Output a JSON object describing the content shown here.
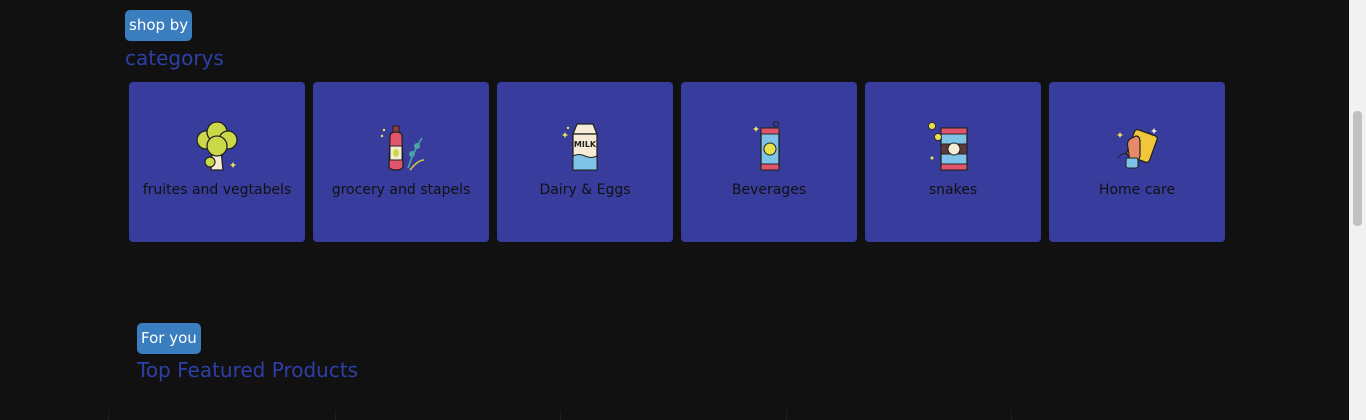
{
  "categories_section": {
    "badge": "shop by",
    "title": "categorys",
    "items": [
      {
        "label": "fruites and vegtabels",
        "icon": "broccoli-icon"
      },
      {
        "label": "grocery and stapels",
        "icon": "oil-bottle-icon"
      },
      {
        "label": "Dairy & Eggs",
        "icon": "milk-carton-icon"
      },
      {
        "label": "Beverages",
        "icon": "soda-can-icon"
      },
      {
        "label": "snakes",
        "icon": "snack-can-icon"
      },
      {
        "label": "Home care",
        "icon": "cleaning-sponge-icon"
      }
    ]
  },
  "featured_section": {
    "badge": "For you",
    "title": "Top Featured Products"
  },
  "colors": {
    "background": "#111111",
    "card": "#383c9c",
    "badge": "#3a7ebf",
    "heading": "#2d3fa8"
  }
}
